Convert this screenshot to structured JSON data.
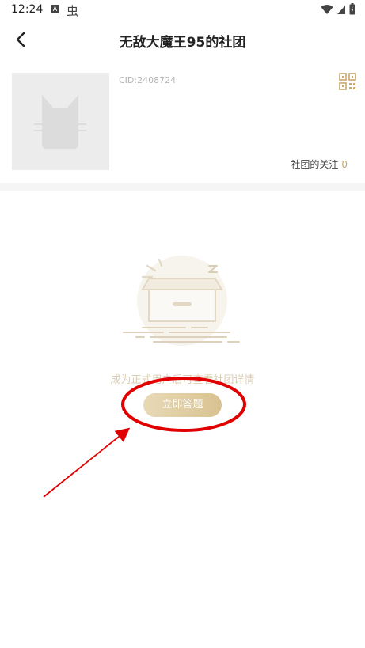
{
  "status_bar": {
    "time": "12:24",
    "a_badge": "A",
    "bug_glyph": "虫"
  },
  "header": {
    "title": "无敌大魔王95的社团"
  },
  "club": {
    "cid": "CID:2408724",
    "follow_label": "社团的关注",
    "follow_count": "0"
  },
  "empty_state": {
    "message": "成为正式用户后可查看社团详情",
    "button_label": "立即答题"
  },
  "colors": {
    "accent": "#c9a86a",
    "annotation": "#e00000"
  }
}
